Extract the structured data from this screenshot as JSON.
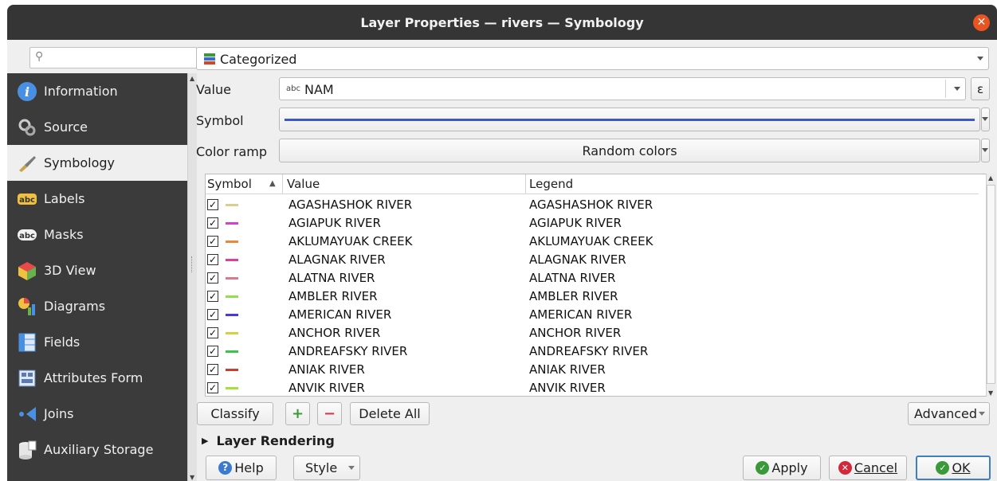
{
  "window": {
    "title": "Layer Properties — rivers — Symbology"
  },
  "search": {
    "placeholder": ""
  },
  "sidebar": {
    "items": [
      {
        "label": "Information",
        "icon": "info-icon"
      },
      {
        "label": "Source",
        "icon": "source-icon"
      },
      {
        "label": "Symbology",
        "icon": "paintbrush-icon",
        "active": true
      },
      {
        "label": "Labels",
        "icon": "labels-icon"
      },
      {
        "label": "Masks",
        "icon": "masks-icon"
      },
      {
        "label": "3D View",
        "icon": "3d-cube-icon"
      },
      {
        "label": "Diagrams",
        "icon": "diagrams-icon"
      },
      {
        "label": "Fields",
        "icon": "fields-icon"
      },
      {
        "label": "Attributes Form",
        "icon": "form-icon"
      },
      {
        "label": "Joins",
        "icon": "joins-icon"
      },
      {
        "label": "Auxiliary Storage",
        "icon": "storage-icon"
      }
    ]
  },
  "renderer": {
    "value": "Categorized"
  },
  "value_field": {
    "label": "Value",
    "type_tag": "abc",
    "value": "NAM",
    "expression_glyph": "ε"
  },
  "symbol_field": {
    "label": "Symbol",
    "color": "#3b58c4"
  },
  "color_ramp": {
    "label": "Color ramp",
    "value": "Random colors"
  },
  "table": {
    "headers": {
      "symbol": "Symbol",
      "value": "Value",
      "legend": "Legend"
    },
    "rows": [
      {
        "checked": "✓",
        "color": "#d7cf8f",
        "value": "AGASHASHOK RIVER",
        "legend": "AGASHASHOK RIVER"
      },
      {
        "checked": "✓",
        "color": "#d63fd6",
        "value": "AGIAPUK RIVER",
        "legend": "AGIAPUK RIVER"
      },
      {
        "checked": "✓",
        "color": "#e88a3c",
        "value": "AKLUMAYUAK CREEK",
        "legend": "AKLUMAYUAK CREEK"
      },
      {
        "checked": "✓",
        "color": "#e23c9c",
        "value": "ALAGNAK RIVER",
        "legend": "ALAGNAK RIVER"
      },
      {
        "checked": "✓",
        "color": "#d97b8f",
        "value": "ALATNA RIVER",
        "legend": "ALATNA RIVER"
      },
      {
        "checked": "✓",
        "color": "#8fe04a",
        "value": "AMBLER RIVER",
        "legend": "AMBLER RIVER"
      },
      {
        "checked": "✓",
        "color": "#4a3ad6",
        "value": "AMERICAN RIVER",
        "legend": "AMERICAN RIVER"
      },
      {
        "checked": "✓",
        "color": "#d4d43a",
        "value": "ANCHOR RIVER",
        "legend": "ANCHOR RIVER"
      },
      {
        "checked": "✓",
        "color": "#3ac44a",
        "value": "ANDREAFSKY RIVER",
        "legend": "ANDREAFSKY RIVER"
      },
      {
        "checked": "✓",
        "color": "#d23a2a",
        "value": "ANIAK RIVER",
        "legend": "ANIAK RIVER"
      },
      {
        "checked": "✓",
        "color": "#a8e03a",
        "value": "ANVIK RIVER",
        "legend": "ANVIK RIVER"
      }
    ]
  },
  "actions": {
    "classify": "Classify",
    "add": "+",
    "remove": "−",
    "delete_all": "Delete All",
    "advanced": "Advanced"
  },
  "layer_rendering": {
    "label": "Layer Rendering"
  },
  "footer": {
    "help": "Help",
    "style": "Style",
    "apply": "Apply",
    "cancel": "Cancel",
    "ok": "OK"
  }
}
